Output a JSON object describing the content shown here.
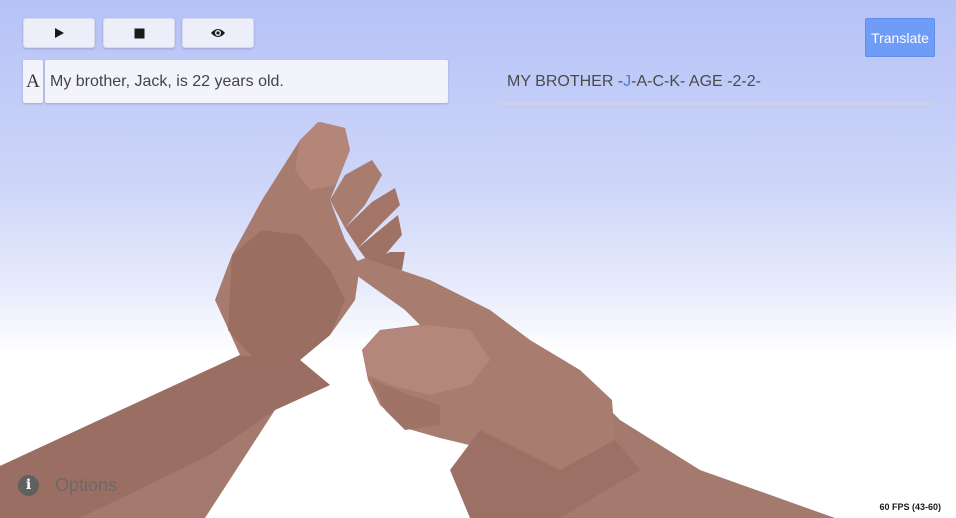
{
  "controls": {
    "play_icon": "play-icon",
    "stop_icon": "stop-icon",
    "view_icon": "eye-icon"
  },
  "translate_button": {
    "label": "Translate",
    "color": "#6f9cf6"
  },
  "input": {
    "font_toggle_label": "A",
    "value": "My brother, Jack, is 22 years old."
  },
  "gloss": {
    "before": "MY BROTHER -",
    "highlight": "J",
    "after": "-A-C-K- AGE -2-2-",
    "highlight_color": "#4a7de8"
  },
  "footer": {
    "info_icon": "info-icon",
    "info_glyph": "i",
    "options_label": "Options",
    "fps_label": "60 FPS (43-60)"
  }
}
